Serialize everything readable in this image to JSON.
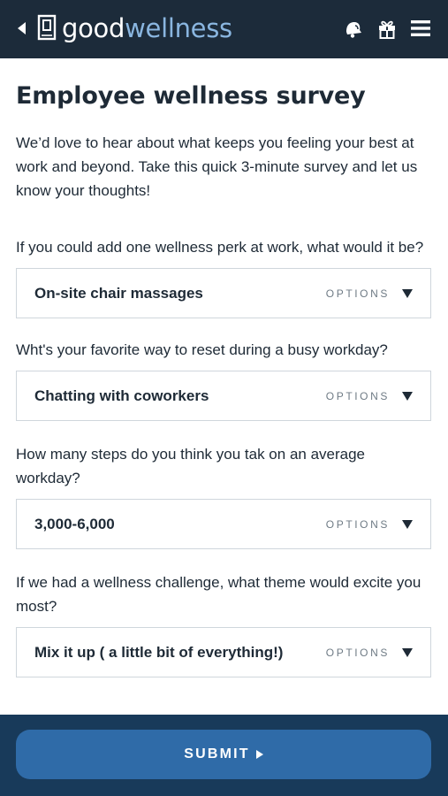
{
  "header": {
    "logo_good": "good",
    "logo_wellness": "wellness",
    "icons": [
      "back-arrow-icon",
      "bell-icon",
      "gift-icon",
      "menu-icon"
    ],
    "colors": {
      "bar": "#1c2b3a",
      "accent": "#8ab6e0"
    }
  },
  "page": {
    "title": "Employee wellness survey",
    "intro": "We’d love to hear about what keeps you feeling your best at work and beyond. Take this quick 3-minute survey and let us know your thoughts!"
  },
  "questions": [
    {
      "text": "If you could add one wellness perk at work, what would it be?",
      "selected": "On-site chair massages",
      "options_label": "OPTIONS"
    },
    {
      "text": "Wht's your favorite way to reset during a busy workday?",
      "selected": "Chatting with coworkers",
      "options_label": "OPTIONS"
    },
    {
      "text": "How many steps do you think you tak on an average workday?",
      "selected": "3,000-6,000",
      "options_label": "OPTIONS"
    },
    {
      "text": "If we had a wellness challenge, what theme would excite you most?",
      "selected": "Mix it up ( a little bit of everything!)",
      "options_label": "OPTIONS"
    }
  ],
  "footer": {
    "submit_label": "SUBMIT",
    "colors": {
      "bar": "#183a5a",
      "button": "#2f6ba8"
    }
  }
}
